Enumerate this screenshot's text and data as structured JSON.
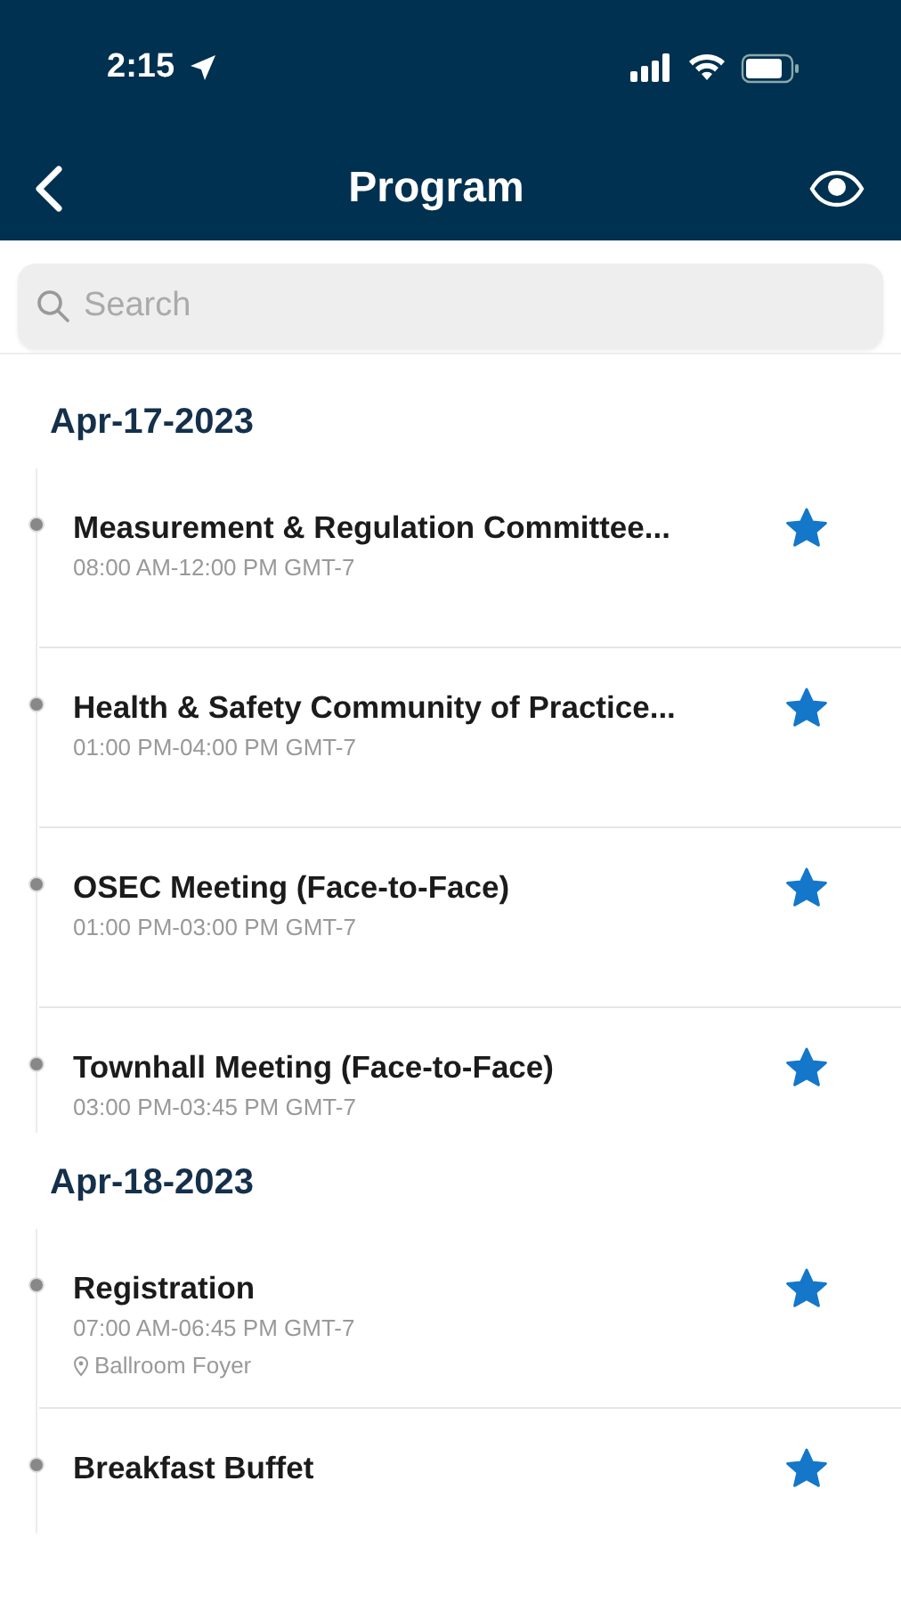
{
  "status_bar": {
    "time": "2:15"
  },
  "nav": {
    "title": "Program"
  },
  "search": {
    "placeholder": "Search"
  },
  "days": [
    {
      "date": "Apr-17-2023",
      "sessions": [
        {
          "title": "Measurement & Regulation Committee...",
          "time": "08:00 AM-12:00 PM GMT-7",
          "starred": true
        },
        {
          "title": "Health & Safety Community of Practice...",
          "time": "01:00 PM-04:00 PM GMT-7",
          "starred": true
        },
        {
          "title": "OSEC Meeting (Face-to-Face)",
          "time": "01:00 PM-03:00 PM GMT-7",
          "starred": true
        },
        {
          "title": "Townhall Meeting (Face-to-Face)",
          "time": "03:00 PM-03:45 PM GMT-7",
          "starred": true
        }
      ]
    },
    {
      "date": "Apr-18-2023",
      "sessions": [
        {
          "title": "Registration",
          "time": "07:00 AM-06:45 PM GMT-7",
          "location": "Ballroom Foyer",
          "starred": true
        },
        {
          "title": "Breakfast Buffet",
          "starred": true
        }
      ]
    }
  ]
}
